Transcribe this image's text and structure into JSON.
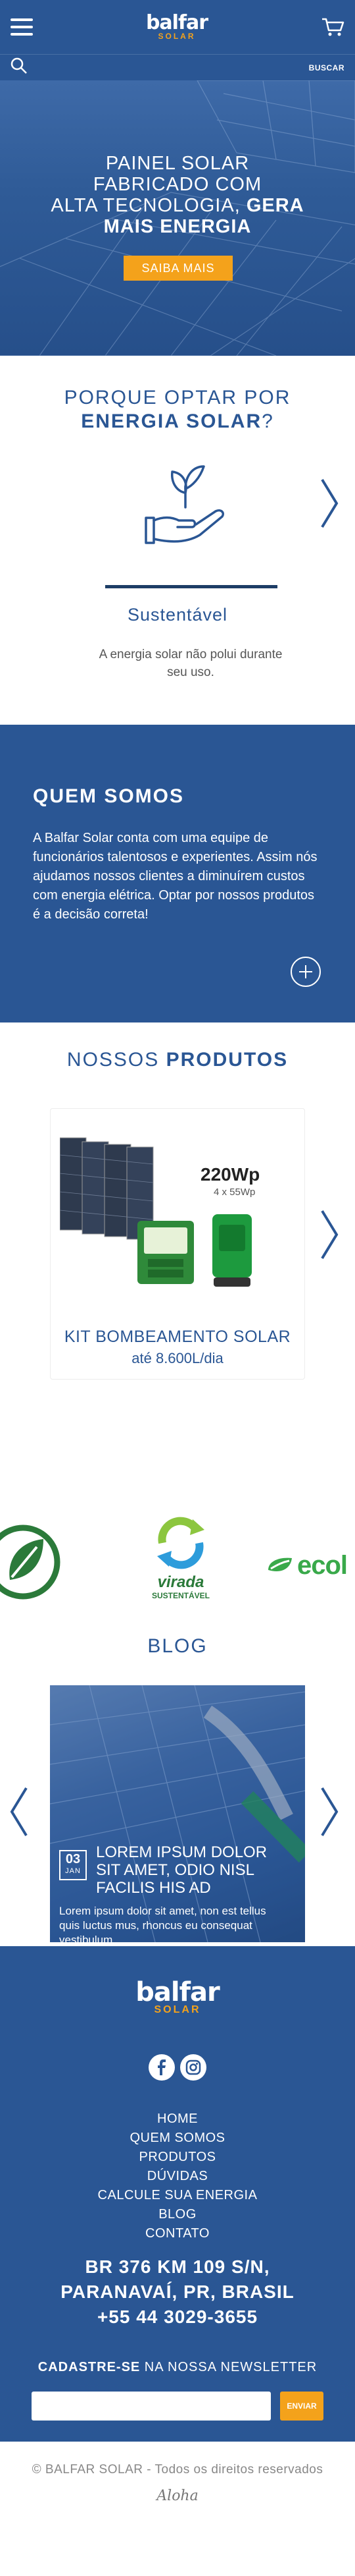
{
  "header": {
    "logo_text": "balfar",
    "logo_sub": "SOLAR"
  },
  "search": {
    "placeholder": "",
    "button_label": "BUSCAR"
  },
  "hero": {
    "line1": "PAINEL SOLAR",
    "line2": "FABRICADO COM",
    "line3_plain": "ALTA TECNOLOGIA, ",
    "line3_bold": "GERA",
    "line4_bold": "MAIS ENERGIA",
    "button_label": "SAIBA MAIS"
  },
  "why": {
    "title_plain": "PORQUE OPTAR POR",
    "title_bold": "ENERGIA SOLAR",
    "title_suffix": "?",
    "item_name": "Sustentável",
    "item_desc": "A energia solar não polui durante seu uso."
  },
  "about": {
    "title": "QUEM SOMOS",
    "text": "A Balfar Solar conta com uma equipe de funcionários talentosos e experientes. Assim nós ajudamos nossos clientes a diminuírem custos com energia elétrica. Optar por nossos produtos é a decisão correta!"
  },
  "products": {
    "title_plain": "NOSSOS ",
    "title_bold": "PRODUTOS",
    "items": [
      {
        "watts": "220Wp",
        "watts_sub": "4 x 55Wp",
        "name": "KIT BOMBEAMENTO SOLAR",
        "detail": "até 8.600L/dia"
      }
    ]
  },
  "partners": {
    "logos": [
      "virada",
      "SUSTENTÁVEL",
      "ecol"
    ]
  },
  "blog": {
    "title": "BLOG",
    "post": {
      "day": "03",
      "month": "JAN",
      "title": "LOREM IPSUM DOLOR SIT AMET, ODIO NISL FACILIS HIS AD",
      "excerpt": "Lorem ipsum dolor sit amet, non est tellus quis luctus mus, rhoncus eu consequat vestibulum."
    }
  },
  "footer": {
    "logo_text": "balfar",
    "logo_sub": "SOLAR",
    "nav": [
      "HOME",
      "QUEM SOMOS",
      "PRODUTOS",
      "DÚVIDAS",
      "CALCULE SUA ENERGIA",
      "BLOG",
      "CONTATO"
    ],
    "address_line1": "BR 376 KM 109 S/N,",
    "address_line2": "PARANAVAÍ, PR, BRASIL",
    "phone": "+55 44 3029-3655",
    "newsletter_bold": "CADASTRE-SE",
    "newsletter_plain": " NA NOSSA NEWSLETTER",
    "newsletter_button": "ENVIAR"
  },
  "bottom": {
    "copyright": "© BALFAR SOLAR - Todos os direitos reservados",
    "signature": "Aloha"
  },
  "colors": {
    "brand_blue": "#2a5694",
    "accent_orange": "#f4a21b",
    "dark_navy": "#1d3d66"
  }
}
